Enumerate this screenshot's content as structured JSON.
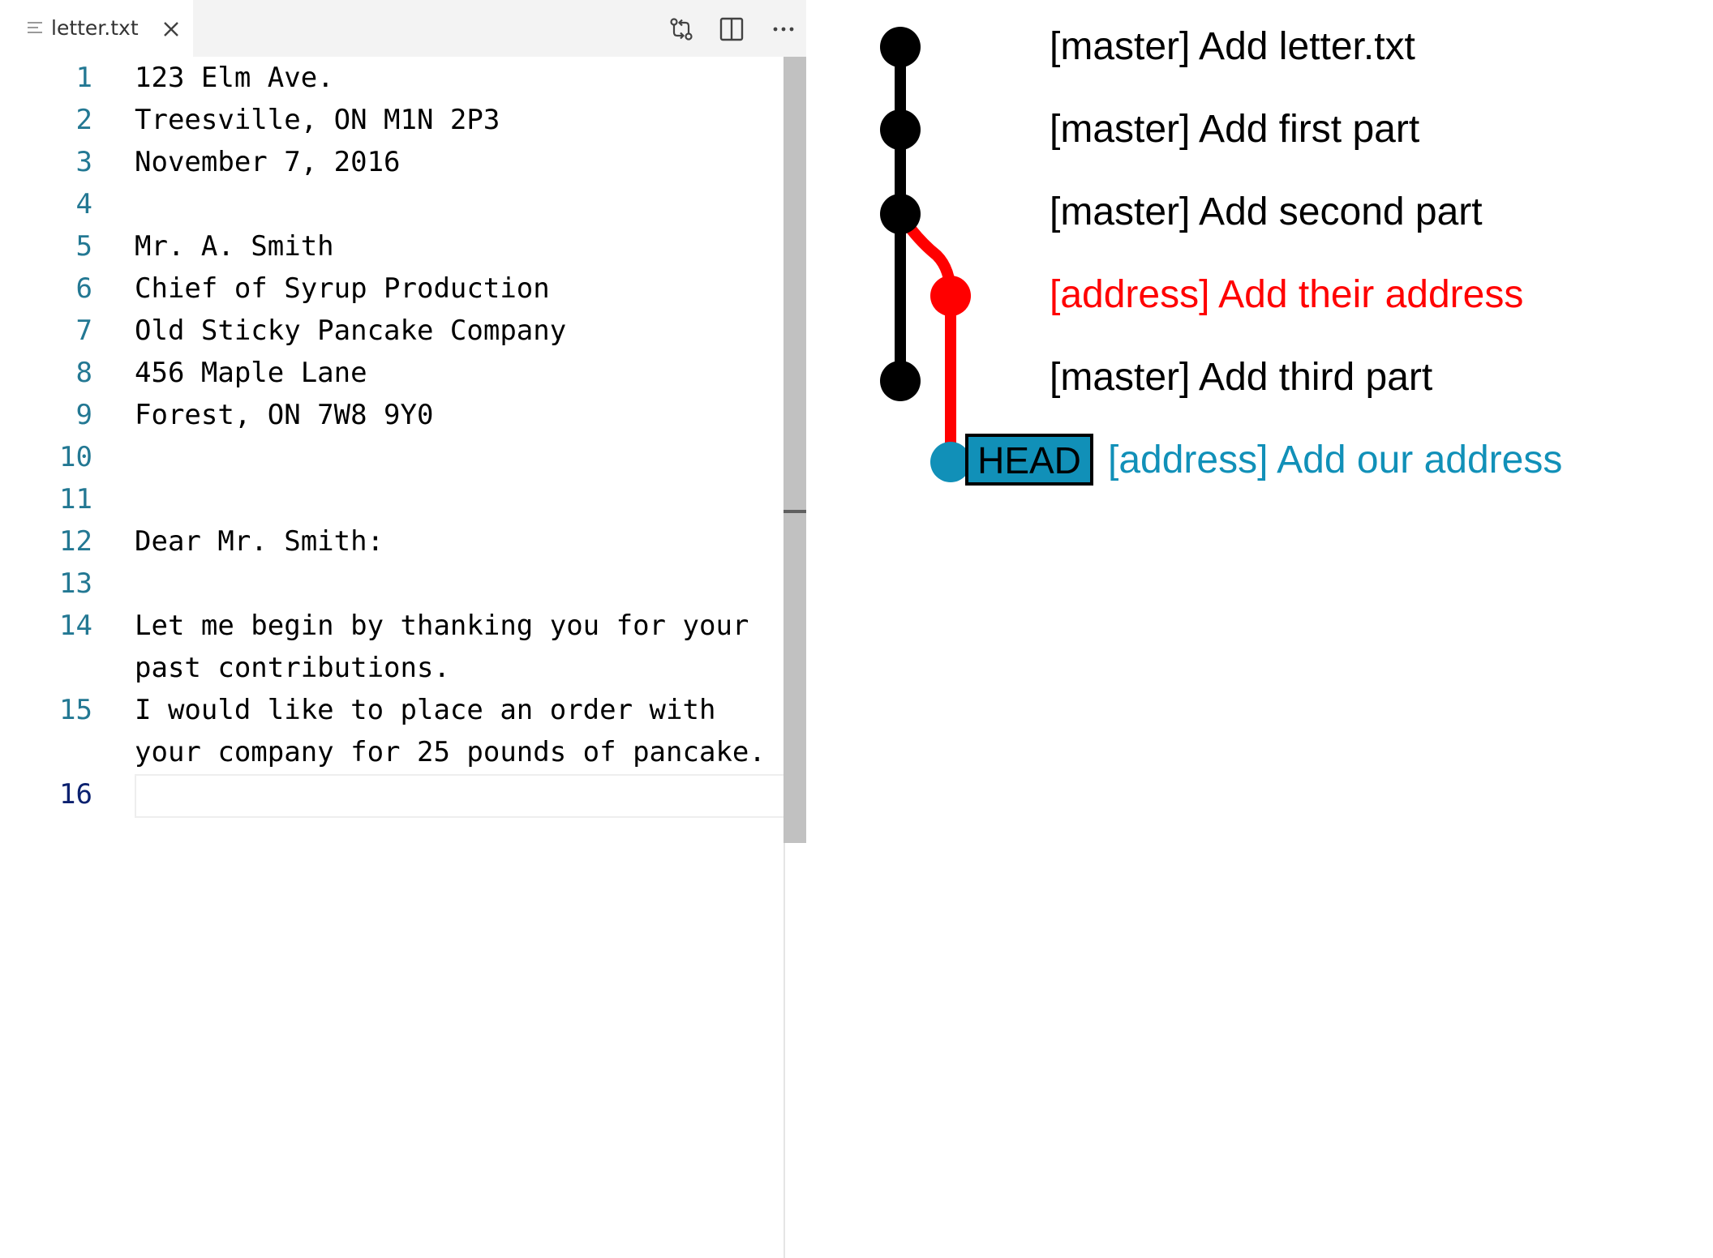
{
  "editor": {
    "tab": {
      "label": "letter.txt"
    },
    "lines": [
      {
        "no": "1",
        "text": "123 Elm Ave."
      },
      {
        "no": "2",
        "text": "Treesville, ON M1N 2P3"
      },
      {
        "no": "3",
        "text": "November 7, 2016"
      },
      {
        "no": "4",
        "text": ""
      },
      {
        "no": "5",
        "text": "Mr. A. Smith"
      },
      {
        "no": "6",
        "text": "Chief of Syrup Production"
      },
      {
        "no": "7",
        "text": "Old Sticky Pancake Company"
      },
      {
        "no": "8",
        "text": "456 Maple Lane"
      },
      {
        "no": "9",
        "text": "Forest, ON 7W8 9Y0"
      },
      {
        "no": "10",
        "text": ""
      },
      {
        "no": "11",
        "text": ""
      },
      {
        "no": "12",
        "text": "Dear Mr. Smith:"
      },
      {
        "no": "13",
        "text": ""
      },
      {
        "no": "14",
        "text": "Let me begin by thanking you for your",
        "wrap": "past contributions."
      },
      {
        "no": "15",
        "text": "I would like to place an order with",
        "wrap": "your company for 25 pounds of pancake."
      },
      {
        "no": "16",
        "text": "",
        "active": true
      }
    ],
    "icons": [
      "list-icon",
      "close-icon",
      "compare-changes-icon",
      "split-editor-icon",
      "more-actions-icon"
    ]
  },
  "graph": {
    "commits": [
      {
        "branch": "[master]",
        "message": "[master] Add letter.txt",
        "color": "#000000"
      },
      {
        "branch": "[master]",
        "message": "[master] Add first part",
        "color": "#000000"
      },
      {
        "branch": "[master]",
        "message": "[master] Add second part",
        "color": "#000000"
      },
      {
        "branch": "[address]",
        "message": "[address] Add their address",
        "color": "#ff0000"
      },
      {
        "branch": "[master]",
        "message": "[master] Add third part",
        "color": "#000000"
      },
      {
        "branch": "[address]",
        "message": "[address] Add our address",
        "color": "#1190b8",
        "head": true
      }
    ],
    "head_label": "HEAD",
    "colors": {
      "master": "#000000",
      "address": "#ff0000",
      "head": "#1190b8"
    }
  }
}
